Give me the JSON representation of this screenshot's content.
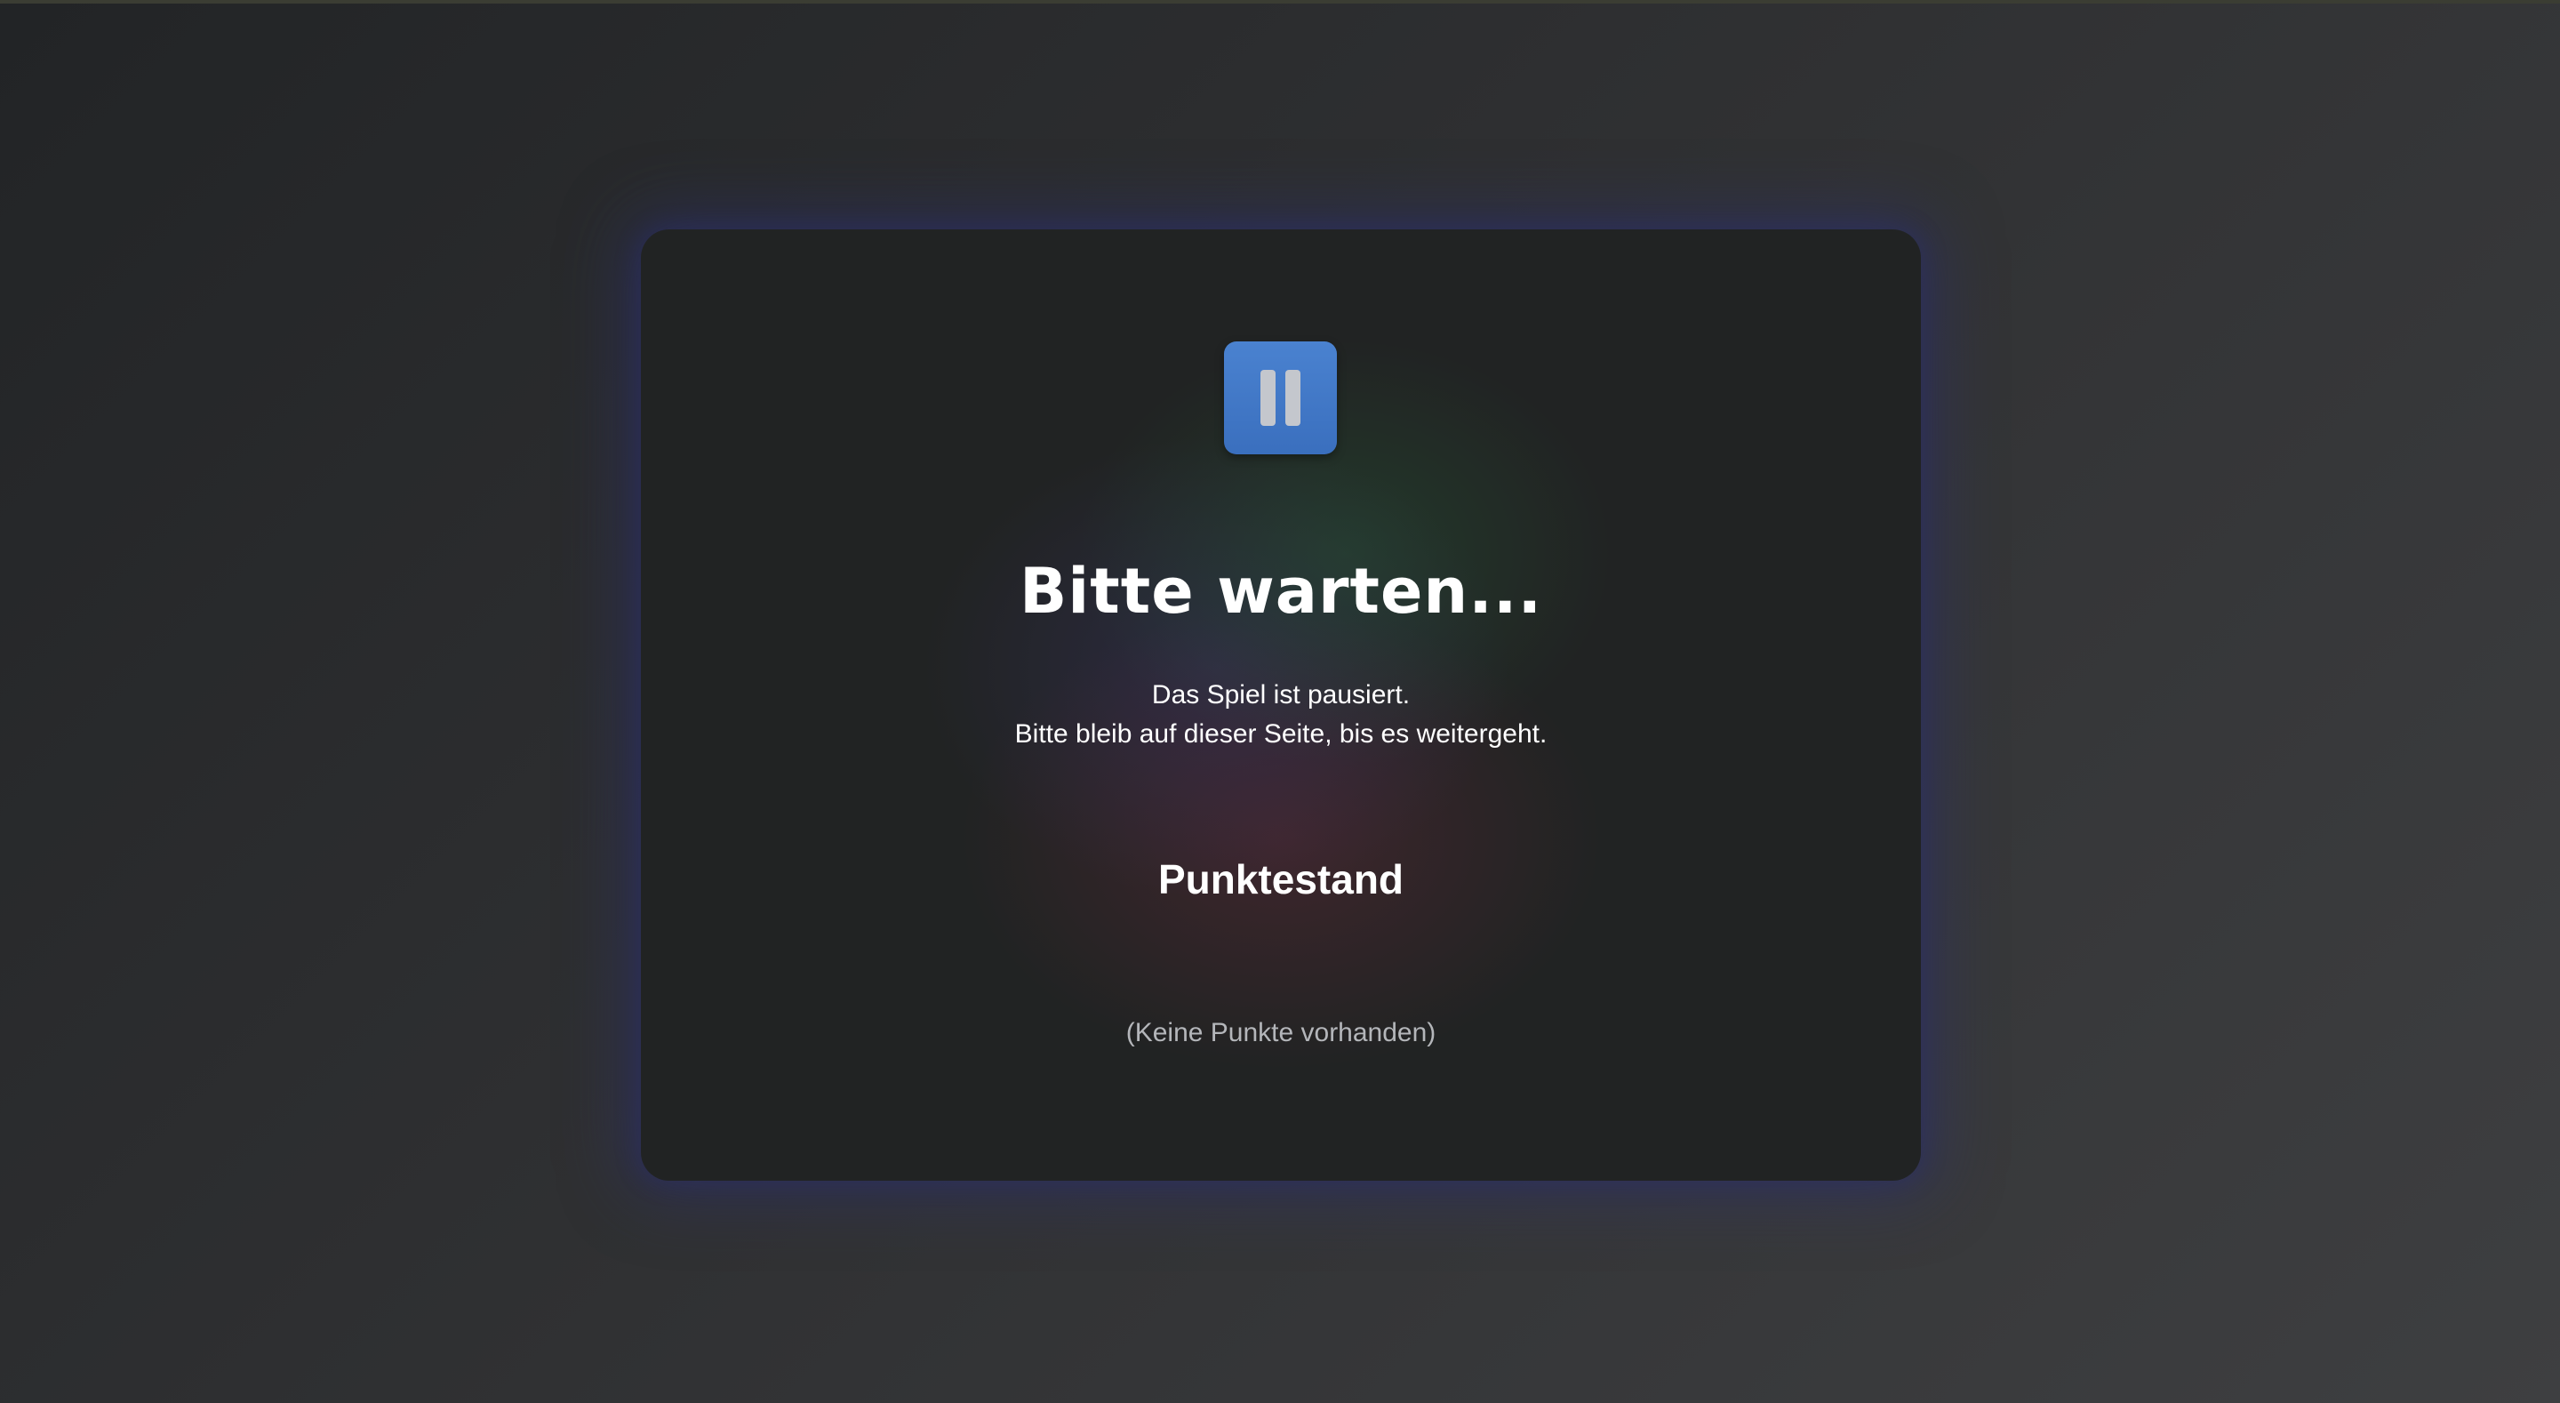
{
  "pause_screen": {
    "icon": "pause-icon",
    "accent_color": "#4a82d0",
    "title": "Bitte warten...",
    "message_lines": [
      "Das Spiel ist pausiert.",
      "Bitte bleib auf dieser Seite, bis es weitergeht."
    ],
    "scoreboard": {
      "heading": "Punktestand",
      "empty_text": "(Keine Punkte vorhanden)"
    }
  }
}
